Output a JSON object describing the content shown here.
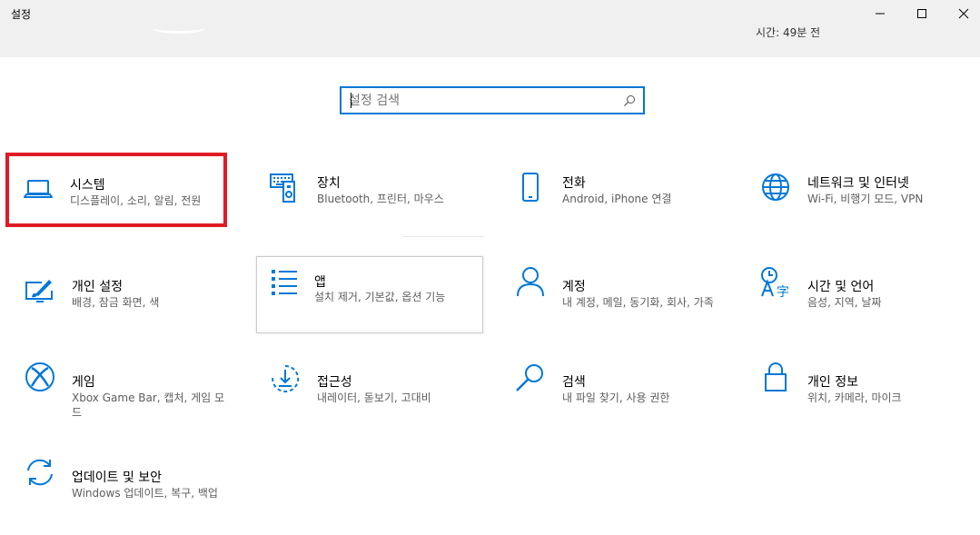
{
  "window": {
    "title": "설정",
    "status_text": "시간: 49분 전"
  },
  "search": {
    "placeholder": "설정 검색",
    "value": ""
  },
  "accent_color": "#0078d7",
  "highlight_color": "#e01b24",
  "tiles": [
    {
      "name": "시스템",
      "desc": "디스플레이, 소리, 알림, 전원",
      "icon": "laptop-icon"
    },
    {
      "name": "장치",
      "desc": "Bluetooth, 프린터, 마우스",
      "icon": "keyboard-devices-icon"
    },
    {
      "name": "전화",
      "desc": "Android, iPhone 연결",
      "icon": "phone-icon"
    },
    {
      "name": "네트워크 및 인터넷",
      "desc": "Wi-Fi, 비행기 모드, VPN",
      "icon": "globe-icon"
    },
    {
      "name": "개인 설정",
      "desc": "배경, 잠금 화면, 색",
      "icon": "paint-brush-icon"
    },
    {
      "name": "앱",
      "desc": "설치 제거, 기본값, 옵션 기능",
      "icon": "apps-list-icon"
    },
    {
      "name": "계정",
      "desc": "내 계정, 메일, 동기화, 회사, 가족",
      "icon": "person-icon"
    },
    {
      "name": "시간 및 언어",
      "desc": "음성, 지역, 날짜",
      "icon": "time-language-icon"
    },
    {
      "name": "게임",
      "desc": "Xbox Game Bar, 캡처, 게임 모드",
      "icon": "xbox-icon"
    },
    {
      "name": "접근성",
      "desc": "내레이터, 돋보기, 고대비",
      "icon": "accessibility-icon"
    },
    {
      "name": "검색",
      "desc": "내 파일 찾기, 사용 권한",
      "icon": "search-icon"
    },
    {
      "name": "개인 정보",
      "desc": "위치, 카메라, 마이크",
      "icon": "lock-icon"
    },
    {
      "name": "업데이트 및 보안",
      "desc": "Windows 업데이트, 복구, 백업",
      "icon": "sync-icon"
    }
  ]
}
